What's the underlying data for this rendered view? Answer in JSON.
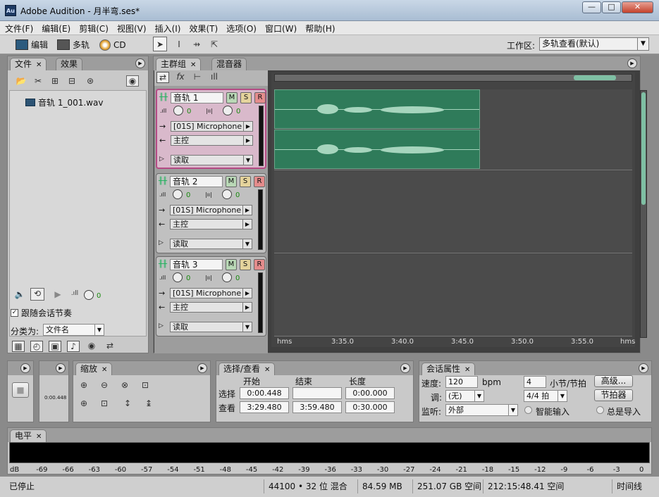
{
  "window": {
    "app_icon": "Au",
    "title": "Adobe Audition - 月半弯.ses*",
    "controls": {
      "minimize": "—",
      "maximize": "□",
      "close": "✕"
    }
  },
  "menu": [
    "文件(F)",
    "编辑(E)",
    "剪辑(C)",
    "视图(V)",
    "插入(I)",
    "效果(T)",
    "选项(O)",
    "窗口(W)",
    "帮助(H)"
  ],
  "toolbar": {
    "edit_label": "编辑",
    "multitrack_label": "多轨",
    "cd_label": "CD",
    "workspace_label": "工作区:",
    "workspace_value": "多轨查看(默认)"
  },
  "files_panel": {
    "tabs": [
      "文件",
      "效果"
    ],
    "files": [
      "音轨 1_001.wav"
    ],
    "knob_value": "0",
    "follow_session_tempo": "跟随会话节奏",
    "sort_label": "分类为:",
    "sort_value": "文件名"
  },
  "main_panel": {
    "tabs": [
      "主群组",
      "混音器"
    ],
    "tracks": [
      {
        "name": "音轨 1",
        "vol": "0",
        "pan": "0",
        "input": "[01S] Microphone",
        "output": "主控",
        "mode": "读取",
        "selected": true
      },
      {
        "name": "音轨 2",
        "vol": "0",
        "pan": "0",
        "input": "[01S] Microphone",
        "output": "主控",
        "mode": "读取",
        "selected": false
      },
      {
        "name": "音轨 3",
        "vol": "0",
        "pan": "0",
        "input": "[01S] Microphone",
        "output": "主控",
        "mode": "读取",
        "selected": false
      }
    ],
    "mute": "M",
    "solo": "S",
    "record": "R",
    "timeline_ticks": [
      "hms",
      "3:35.0",
      "3:40.0",
      "3:45.0",
      "3:50.0",
      "3:55.0",
      "hms"
    ]
  },
  "transport_panel": {
    "time_small": "0:00.448"
  },
  "zoom_panel": {
    "title": "缩放"
  },
  "selection_panel": {
    "title": "选择/查看",
    "headers": [
      "开始",
      "结束",
      "长度"
    ],
    "rows": [
      {
        "label": "选择",
        "start": "0:00.448",
        "end": "",
        "length": "0:00.000"
      },
      {
        "label": "查看",
        "start": "3:29.480",
        "end": "3:59.480",
        "length": "0:30.000"
      }
    ]
  },
  "session_panel": {
    "title": "会话属性",
    "tempo_label": "速度:",
    "tempo_value": "120",
    "bpm": "bpm",
    "beats_value": "4",
    "beats_label": "小节/节拍",
    "advanced": "高级...",
    "key_label": "调:",
    "key_value": "(无)",
    "time_sig": "4/4 拍",
    "metronome": "节拍器",
    "monitor_label": "监听:",
    "monitor_value": "外部",
    "smart_input": "智能输入",
    "always_input": "总是导入"
  },
  "level_panel": {
    "title": "电平",
    "scale": [
      "dB",
      "-69",
      "-66",
      "-63",
      "-60",
      "-57",
      "-54",
      "-51",
      "-48",
      "-45",
      "-42",
      "-39",
      "-36",
      "-33",
      "-30",
      "-27",
      "-24",
      "-21",
      "-18",
      "-15",
      "-12",
      "-9",
      "-6",
      "-3",
      "0"
    ]
  },
  "status": {
    "state": "已停止",
    "format": "44100 • 32 位 混合",
    "size": "84.59 MB",
    "free_space": "251.07 GB 空间",
    "free_time": "212:15:48.41 空间",
    "timeline": "时间线"
  }
}
